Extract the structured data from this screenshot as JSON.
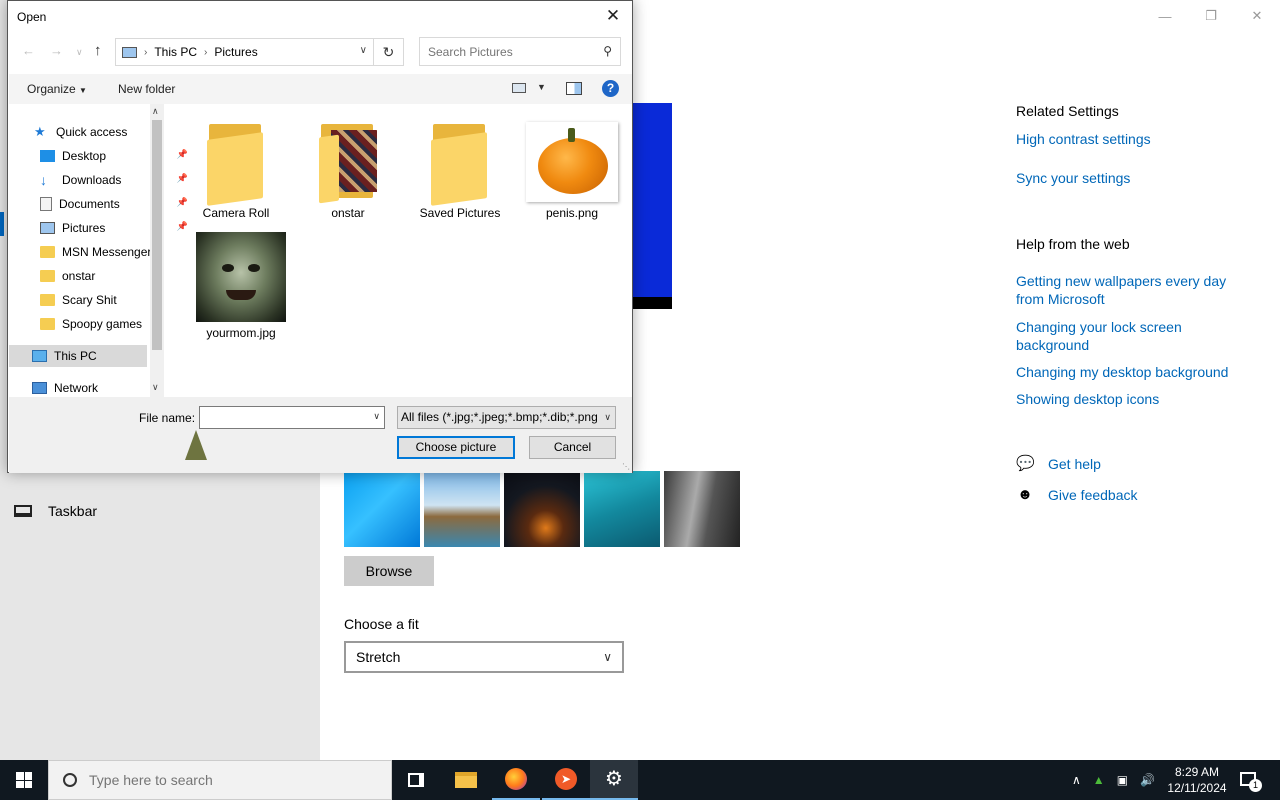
{
  "settings": {
    "nav_taskbar": "Taskbar",
    "browse_label": "Browse",
    "fit": {
      "label": "Choose a fit",
      "value": "Stretch"
    },
    "related": {
      "title": "Related Settings",
      "links": [
        "High contrast settings",
        "Sync your settings"
      ]
    },
    "help_web": {
      "title": "Help from the web",
      "links": [
        "Getting new wallpapers every day from Microsoft",
        "Changing your lock screen background",
        "Changing my desktop background",
        "Showing desktop icons"
      ]
    },
    "get_help": "Get help",
    "give_feedback": "Give feedback"
  },
  "dialog": {
    "title": "Open",
    "breadcrumb": [
      "This PC",
      "Pictures"
    ],
    "search_placeholder": "Search Pictures",
    "toolbar": {
      "organize": "Organize",
      "new_folder": "New folder"
    },
    "nav": {
      "quick_access": "Quick access",
      "items": [
        "Desktop",
        "Downloads",
        "Documents",
        "Pictures",
        "MSN Messenger",
        "onstar",
        "Scary Shit",
        "Spoopy games"
      ],
      "this_pc": "This PC",
      "network": "Network"
    },
    "files": [
      "Camera Roll",
      "onstar",
      "Saved Pictures",
      "penis.png",
      "yourmom.jpg"
    ],
    "file_name_label": "File name:",
    "file_type": "All files (*.jpg;*.jpeg;*.bmp;*.dib;*.png",
    "choose_button": "Choose picture",
    "cancel_button": "Cancel"
  },
  "taskbar": {
    "search_placeholder": "Type here to search",
    "time": "8:29 AM",
    "date": "12/11/2024",
    "notification_count": "1"
  }
}
